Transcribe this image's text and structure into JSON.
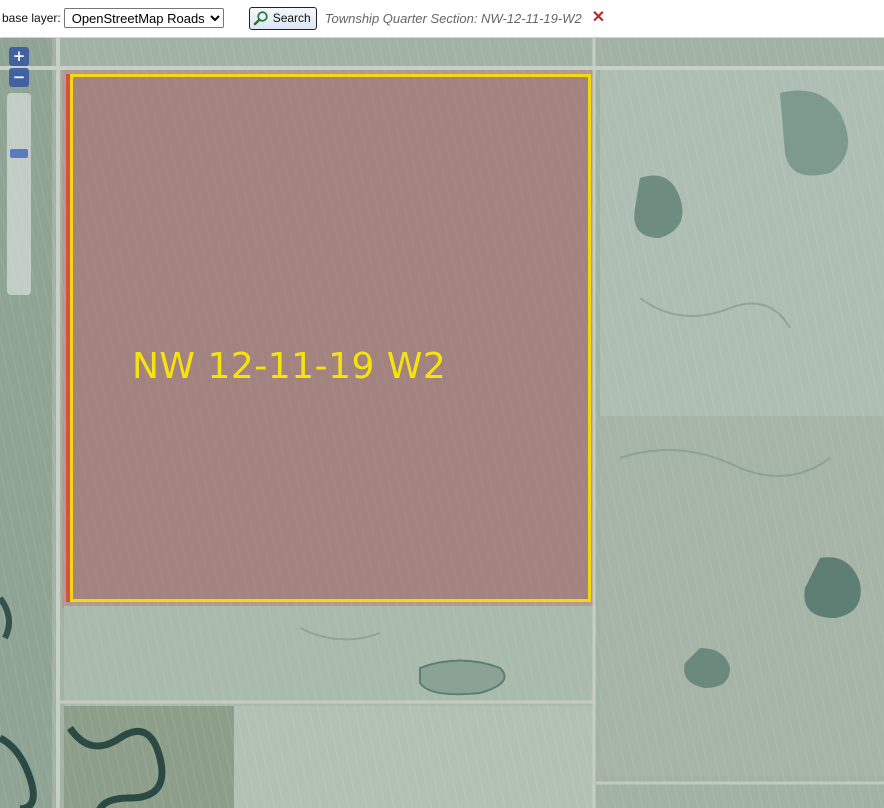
{
  "toolbar": {
    "base_layer_label": "base layer:",
    "base_layer_selected": "OpenStreetMap Roads",
    "search_label": "Search",
    "search_status": "Township Quarter Section: NW-12-11-19-W2",
    "clear_symbol": "✕"
  },
  "map": {
    "zoom_in_label": "+",
    "zoom_out_label": "−",
    "zoom_level_fraction": 0.28,
    "parcel_label": "NW 12-11-19 W2",
    "parcel_outline_color": "#f3d80f",
    "parcel_fill_color": "#967070",
    "label_color": "#f6e30d"
  },
  "icons": {
    "search": "magnifier-icon",
    "clear": "close-icon"
  }
}
